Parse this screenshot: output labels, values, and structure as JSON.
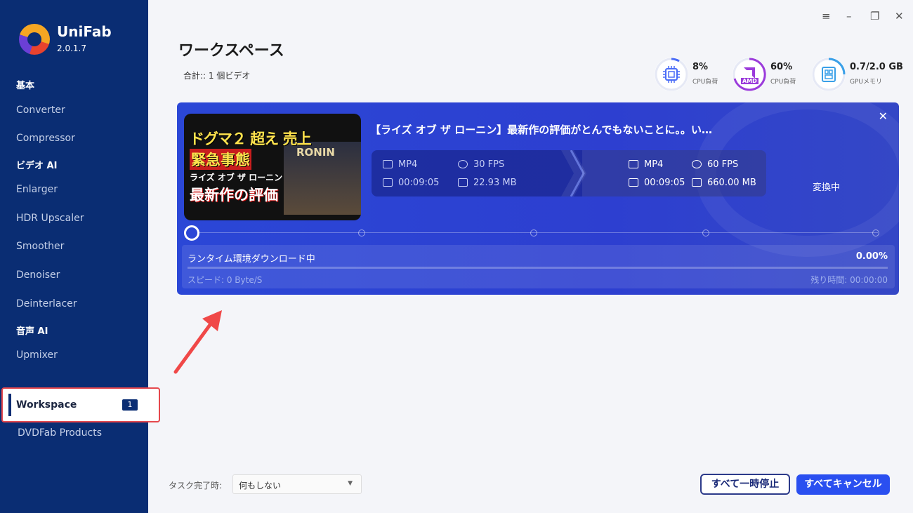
{
  "app": {
    "name": "UniFab",
    "version": "2.0.1.7"
  },
  "sidebar": {
    "sections": [
      {
        "title": "基本",
        "items": [
          "Converter",
          "Compressor"
        ]
      },
      {
        "title": "ビデオ AI",
        "items": [
          "Enlarger",
          "HDR Upscaler",
          "Smoother",
          "Denoiser",
          "Deinterlacer"
        ]
      },
      {
        "title": "音声 AI",
        "items": [
          "Upmixer"
        ]
      }
    ],
    "workspace": {
      "label": "Workspace",
      "badge": "1"
    },
    "dvdfab": "DVDFab Products"
  },
  "window_controls": [
    "≡",
    "–",
    "❐",
    "✕"
  ],
  "header": {
    "title": "ワークスペース",
    "total": "合計:: 1 個ビデオ"
  },
  "stats": [
    {
      "icon": "cpu-icon",
      "value": "8%",
      "label": "CPU負荷"
    },
    {
      "icon": "amd-icon",
      "value": "60%",
      "label": "CPU負荷",
      "chip_text": "AMD"
    },
    {
      "icon": "gpu-memory-icon",
      "value": "0.7/2.0 GB",
      "label": "GPUメモリ"
    }
  ],
  "task": {
    "title": "【ライズ オブ ザ ローニン】最新作の評価がとんでもないことに。。い…",
    "thumbnail": {
      "line1": "ドグマ２ 超え 売上",
      "line2": "緊急事態",
      "line3": "ライズ オブ ザ ローニン",
      "line4": "最新作の評価",
      "logo": "RONIN"
    },
    "source": {
      "format": "MP4",
      "fps": "30 FPS",
      "duration": "00:09:05",
      "size": "22.93 MB"
    },
    "target": {
      "format": "MP4",
      "fps": "60 FPS",
      "duration": "00:09:05",
      "size": "660.00 MB"
    },
    "status": "変換中",
    "progress_message": "ランタイム環境ダウンロード中",
    "progress_percent": "0.00%",
    "progress_value": 0,
    "speed": "スピード: 0 Byte/S",
    "remaining": "残り時間: 00:00:00"
  },
  "footer": {
    "on_complete_label": "タスク完了時:",
    "on_complete_value": "何もしない",
    "pause_all": "すべて一時停止",
    "cancel_all": "すべてキャンセル"
  },
  "colors": {
    "sidebar": "#0a2d73",
    "card": "#2b47d6",
    "accent": "#2a4ff0",
    "highlight": "#e5484d"
  }
}
